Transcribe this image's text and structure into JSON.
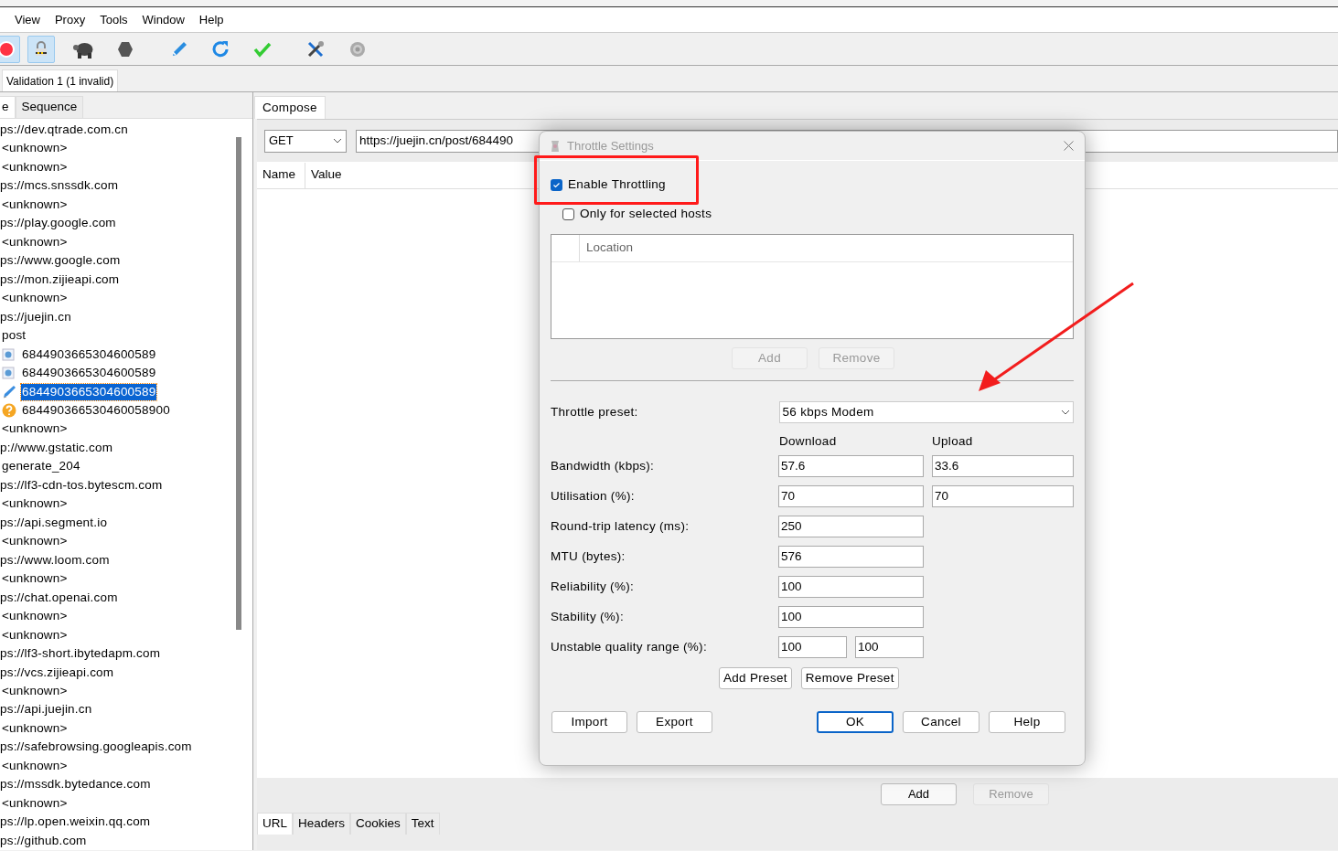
{
  "menu": [
    "View",
    "Proxy",
    "Tools",
    "Window",
    "Help"
  ],
  "toolbar": [
    {
      "kind": "record",
      "pressed": true
    },
    {
      "kind": "lock",
      "pressed": true
    },
    {
      "kind": "turtle",
      "pressed": false
    },
    {
      "kind": "stop",
      "pressed": false
    },
    {
      "kind": "pen",
      "pressed": false
    },
    {
      "kind": "refresh",
      "pressed": false
    },
    {
      "kind": "check",
      "pressed": false
    },
    {
      "kind": "tools",
      "pressed": false
    },
    {
      "kind": "gear",
      "pressed": false
    }
  ],
  "session_tabs": [
    {
      "label": "Validation 1 (1 invalid)",
      "selected": true
    }
  ],
  "left_tabs": [
    {
      "label": "e",
      "selected": true
    },
    {
      "label": "Sequence",
      "selected": false
    }
  ],
  "tree": [
    {
      "text": "ps://dev.qtrade.com.cn",
      "children": [
        {
          "text": "<unknown>"
        },
        {
          "text": "<unknown>"
        }
      ]
    },
    {
      "text": "ps://mcs.snssdk.com",
      "children": [
        {
          "text": "<unknown>"
        }
      ]
    },
    {
      "text": "ps://play.google.com",
      "children": [
        {
          "text": "<unknown>"
        }
      ]
    },
    {
      "text": "ps://www.google.com"
    },
    {
      "text": "ps://mon.zijieapi.com",
      "children": [
        {
          "text": "<unknown>"
        }
      ]
    },
    {
      "text": "ps://juejin.cn",
      "children": [
        {
          "text": "post",
          "children": [
            {
              "text": "6844903665304600589",
              "kind": "document",
              "selected": false
            },
            {
              "text": "6844903665304600589",
              "kind": "document",
              "selected": false
            },
            {
              "text": "6844903665304600589",
              "kind": "composer",
              "selected": true
            },
            {
              "text": "684490366530460058900",
              "kind": "warning",
              "selected": false
            }
          ]
        },
        {
          "text": "<unknown>"
        }
      ]
    },
    {
      "text": "p://www.gstatic.com",
      "children": [
        {
          "text": "generate_204"
        }
      ]
    },
    {
      "text": "ps://lf3-cdn-tos.bytescm.com",
      "children": [
        {
          "text": "<unknown>"
        }
      ]
    },
    {
      "text": "ps://api.segment.io",
      "children": [
        {
          "text": "<unknown>"
        }
      ]
    },
    {
      "text": "ps://www.loom.com",
      "children": [
        {
          "text": "<unknown>"
        }
      ]
    },
    {
      "text": "ps://chat.openai.com",
      "children": [
        {
          "text": "<unknown>"
        },
        {
          "text": "<unknown>"
        }
      ]
    },
    {
      "text": "ps://lf3-short.ibytedapm.com"
    },
    {
      "text": "ps://vcs.zijieapi.com",
      "children": [
        {
          "text": "<unknown>"
        }
      ]
    },
    {
      "text": "ps://api.juejin.cn",
      "children": [
        {
          "text": "<unknown>"
        }
      ]
    },
    {
      "text": "ps://safebrowsing.googleapis.com",
      "children": [
        {
          "text": "<unknown>"
        }
      ]
    },
    {
      "text": "ps://mssdk.bytedance.com",
      "children": [
        {
          "text": "<unknown>"
        }
      ]
    },
    {
      "text": "ps://lp.open.weixin.qq.com"
    },
    {
      "text": "ps://github.com"
    }
  ],
  "compose": {
    "tab": {
      "label": "Compose",
      "selected": true
    },
    "method": "GET",
    "url": "https://juejin.cn/post/684490",
    "columns": [
      "Name",
      "Value"
    ],
    "buttons": [
      {
        "label": "Add",
        "disabled": false
      },
      {
        "label": "Remove",
        "disabled": true
      }
    ],
    "tabs": [
      {
        "label": "URL",
        "selected": true
      },
      {
        "label": "Headers",
        "selected": false
      },
      {
        "label": "Cookies",
        "selected": false
      },
      {
        "label": "Text",
        "selected": false
      }
    ]
  },
  "dialog": {
    "title": "Throttle Settings",
    "enable_throttling": {
      "label": "Enable Throttling",
      "checked": true
    },
    "only_selected_hosts": {
      "label": "Only for selected hosts",
      "checked": false
    },
    "hosts_table": {
      "columns": [
        "Location"
      ]
    },
    "host_buttons": [
      {
        "label": "Add",
        "disabled": true
      },
      {
        "label": "Remove",
        "disabled": true
      }
    ],
    "preset_label": "Throttle preset:",
    "preset": "56 kbps Modem",
    "column_headers": [
      "Download",
      "Upload"
    ],
    "rows": [
      {
        "label": "Bandwidth (kbps):",
        "download": "57.6",
        "upload": "33.6"
      },
      {
        "label": "Utilisation (%):",
        "download": "70",
        "upload": "70"
      },
      {
        "label": "Round-trip latency (ms):",
        "download": "250"
      },
      {
        "label": "MTU (bytes):",
        "download": "576"
      },
      {
        "label": "Reliability (%):",
        "download": "100"
      },
      {
        "label": "Stability (%):",
        "download": "100"
      },
      {
        "label": "Unstable quality range (%):",
        "range": [
          "100",
          "100"
        ]
      }
    ],
    "preset_buttons": [
      "Add Preset",
      "Remove Preset"
    ],
    "footer_left": [
      "Import",
      "Export"
    ],
    "footer_right": [
      {
        "label": "OK",
        "default": true
      },
      {
        "label": "Cancel",
        "default": false
      },
      {
        "label": "Help",
        "default": false
      }
    ]
  }
}
